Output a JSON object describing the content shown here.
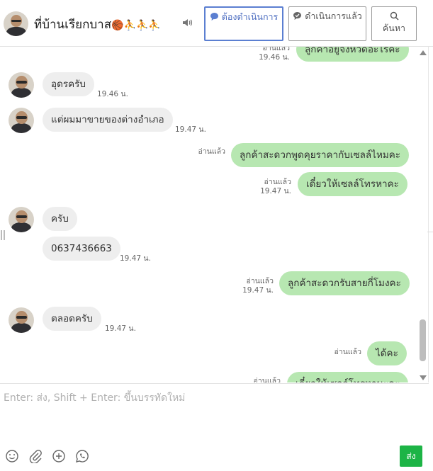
{
  "header": {
    "title": "ที่บ้านเรียกบาส",
    "title_emoji": "🏀⛹⛹⛹",
    "buttons": {
      "todo": "ต้องดำเนินการ",
      "done": "ดำเนินการแล้ว",
      "search": "ค้นหา"
    }
  },
  "messages": [
    {
      "side": "out",
      "text": "ลูกค้าอยู่จังหวัดอะไรคะ",
      "read": "อ่านแล้ว",
      "time": "19.46 น."
    },
    {
      "side": "in",
      "text": "อุดรครับ",
      "time": "19.46 น."
    },
    {
      "side": "in",
      "text": "แต่ผมมาขายของต่างอำเภอ",
      "time": "19.47 น."
    },
    {
      "side": "out",
      "text": "ลูกค้าสะดวกพูดคุยราคากับเซลล์ไหมคะ",
      "read": "อ่านแล้ว",
      "time": ""
    },
    {
      "side": "out",
      "text": "เดี๋ยวให้เซลล์โทรหาคะ",
      "read": "อ่านแล้ว",
      "time": "19.47 น."
    },
    {
      "side": "in",
      "text": "ครับ",
      "time": ""
    },
    {
      "side": "in",
      "text": "0637436663",
      "time": "19.47 น."
    },
    {
      "side": "out",
      "text": "ลูกค้าสะดวกรับสายกี่โมงคะ",
      "read": "อ่านแล้ว",
      "time": "19.47 น."
    },
    {
      "side": "in",
      "text": "ตลอดครับ",
      "time": "19.47 น."
    },
    {
      "side": "out",
      "text": "ได้คะ",
      "read": "อ่านแล้ว",
      "time": ""
    },
    {
      "side": "out",
      "text": "เดี๋ยวให้เซลล์โทรหานะคะ",
      "read": "อ่านแล้ว",
      "time": ""
    }
  ],
  "composer": {
    "placeholder": "Enter: ส่ง, Shift + Enter: ขึ้นบรรทัดใหม่",
    "send_label": "ส่ง"
  },
  "colors": {
    "outgoing_bubble": "#b7e7b1",
    "incoming_bubble": "#eeeeee",
    "send_button": "#1db446",
    "active_button": "#5b7fd1"
  },
  "icons": [
    "speaker-icon",
    "chat-bubble-icon",
    "check-bubble-icon",
    "search-icon",
    "emoji-icon",
    "paperclip-icon",
    "add-circle-icon",
    "whatsapp-icon"
  ]
}
